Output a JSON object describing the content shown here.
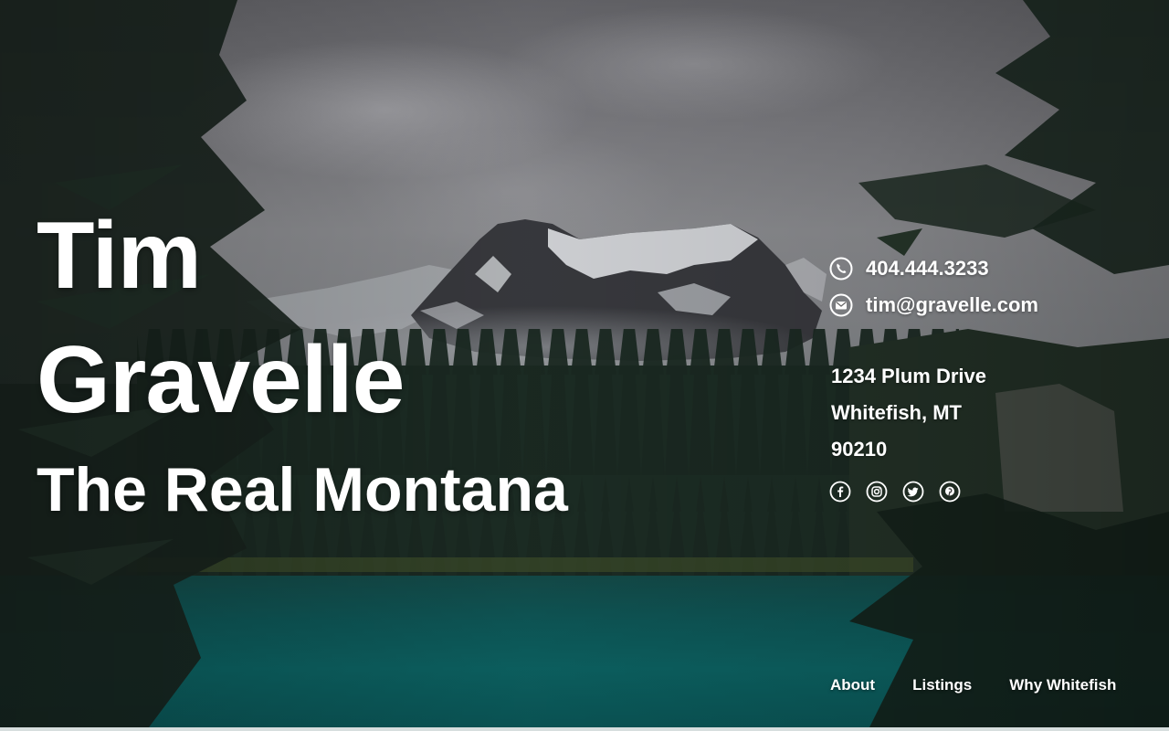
{
  "hero": {
    "first_name": "Tim",
    "last_name": "Gravelle",
    "tagline": "The Real Montana"
  },
  "contact": {
    "phone": "404.444.3233",
    "email": "tim@gravelle.com",
    "phone_icon": "phone-icon",
    "email_icon": "mail-icon"
  },
  "address": {
    "street": "1234 Plum Drive",
    "city_state": "Whitefish, MT",
    "zip": "90210"
  },
  "social": [
    {
      "icon": "facebook-icon"
    },
    {
      "icon": "instagram-icon"
    },
    {
      "icon": "twitter-icon"
    },
    {
      "icon": "pinterest-icon"
    }
  ],
  "nav": {
    "items": [
      {
        "label": "About"
      },
      {
        "label": "Listings"
      },
      {
        "label": "Why Whitefish"
      }
    ]
  },
  "colors": {
    "text": "#ffffff",
    "lake": "#0d6a6a",
    "sky": "#8a8a8f",
    "forest": "#1c2a22"
  }
}
